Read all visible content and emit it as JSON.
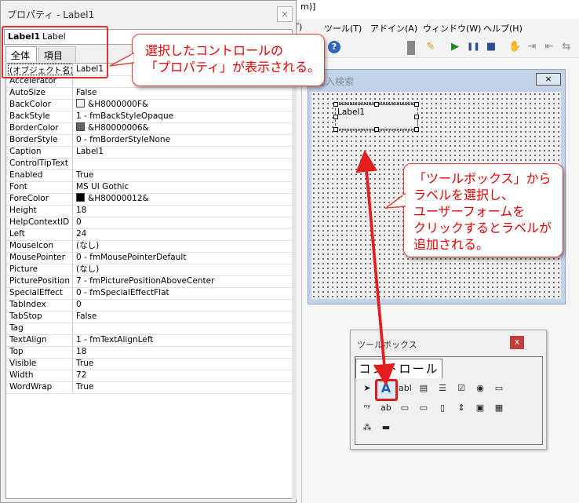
{
  "background_vbe": {
    "title_fragment": "m)]",
    "menus": [
      "(T)",
      "ツール(T)",
      "アドイン(A)",
      "ウィンドウ(W)",
      "ヘルプ(H)"
    ],
    "toolbar_icons": [
      "help-icon",
      "design-mode-icon",
      "run-icon",
      "pause-icon",
      "stop-icon",
      "hand-icon",
      "indent-icon",
      "outdent-icon",
      "toggle-icon"
    ]
  },
  "properties": {
    "title": "プロパティ - Label1",
    "close_glyph": "×",
    "object_name": "Label1",
    "object_type": "Label",
    "tabs": [
      "全体",
      "項目別"
    ],
    "rows": [
      {
        "name": "(オブジェクト名)",
        "value": "Label1"
      },
      {
        "name": "Accelerator",
        "value": ""
      },
      {
        "name": "AutoSize",
        "value": "False"
      },
      {
        "name": "BackColor",
        "value": "&H8000000F&",
        "swatch": "#f0f0f0"
      },
      {
        "name": "BackStyle",
        "value": "1 - fmBackStyleOpaque"
      },
      {
        "name": "BorderColor",
        "value": "&H80000006&",
        "swatch": "#646464"
      },
      {
        "name": "BorderStyle",
        "value": "0 - fmBorderStyleNone"
      },
      {
        "name": "Caption",
        "value": "Label1"
      },
      {
        "name": "ControlTipText",
        "value": ""
      },
      {
        "name": "Enabled",
        "value": "True"
      },
      {
        "name": "Font",
        "value": "MS UI Gothic"
      },
      {
        "name": "ForeColor",
        "value": "&H80000012&",
        "swatch": "#000000"
      },
      {
        "name": "Height",
        "value": "18"
      },
      {
        "name": "HelpContextID",
        "value": "0"
      },
      {
        "name": "Left",
        "value": "24"
      },
      {
        "name": "MouseIcon",
        "value": "(なし)"
      },
      {
        "name": "MousePointer",
        "value": "0 - fmMousePointerDefault"
      },
      {
        "name": "Picture",
        "value": "(なし)"
      },
      {
        "name": "PicturePosition",
        "value": "7 - fmPicturePositionAboveCenter"
      },
      {
        "name": "SpecialEffect",
        "value": "0 - fmSpecialEffectFlat"
      },
      {
        "name": "TabIndex",
        "value": "0"
      },
      {
        "name": "TabStop",
        "value": "False"
      },
      {
        "name": "Tag",
        "value": ""
      },
      {
        "name": "TextAlign",
        "value": "1 - fmTextAlignLeft"
      },
      {
        "name": "Top",
        "value": "18"
      },
      {
        "name": "Visible",
        "value": "True"
      },
      {
        "name": "Width",
        "value": "72"
      },
      {
        "name": "WordWrap",
        "value": "True"
      }
    ]
  },
  "userform": {
    "title": "記入検索",
    "close_glyph": "×",
    "label_caption": "Label1"
  },
  "toolbox": {
    "title": "ツールボックス",
    "close_glyph": "x",
    "tab_label": "コントロール",
    "tools_row1": [
      {
        "name": "select-objects-icon",
        "glyph": "➤"
      },
      {
        "name": "label-tool-icon",
        "glyph": "A"
      },
      {
        "name": "textbox-tool-icon",
        "glyph": "abl"
      },
      {
        "name": "combobox-tool-icon",
        "glyph": "▤"
      },
      {
        "name": "listbox-tool-icon",
        "glyph": "☰"
      },
      {
        "name": "checkbox-tool-icon",
        "glyph": "☑"
      },
      {
        "name": "optionbutton-tool-icon",
        "glyph": "◉"
      },
      {
        "name": "togglebutton-tool-icon",
        "glyph": "▭"
      }
    ],
    "tools_row2": [
      {
        "name": "frame-tool-icon",
        "glyph": "ⁿʸ"
      },
      {
        "name": "commandbutton-tool-icon",
        "glyph": "ab"
      },
      {
        "name": "tabstrip-tool-icon",
        "glyph": "▭"
      },
      {
        "name": "multipage-tool-icon",
        "glyph": "▭"
      },
      {
        "name": "scrollbar-tool-icon",
        "glyph": "▯"
      },
      {
        "name": "spinbutton-tool-icon",
        "glyph": "⇕"
      },
      {
        "name": "image-tool-icon",
        "glyph": "▣"
      },
      {
        "name": "refedit-tool-icon",
        "glyph": "▦"
      }
    ],
    "tools_row3": [
      {
        "name": "extra-tool-1-icon",
        "glyph": "⁂"
      },
      {
        "name": "extra-tool-2-icon",
        "glyph": "▬"
      }
    ]
  },
  "callouts": {
    "properties_note": [
      "選択したコントロールの",
      "「プロパティ」が表示される。"
    ],
    "toolbox_note": [
      "「ツールボックス」から",
      "ラベルを選択し、",
      "ユーザーフォームを",
      "クリックするとラベルが",
      "追加される。"
    ]
  },
  "colors": {
    "callout_text": "#e00000",
    "callout_border": "#e23b3b",
    "arrow": "#e41e1e",
    "highlight": "#d91c1c"
  }
}
